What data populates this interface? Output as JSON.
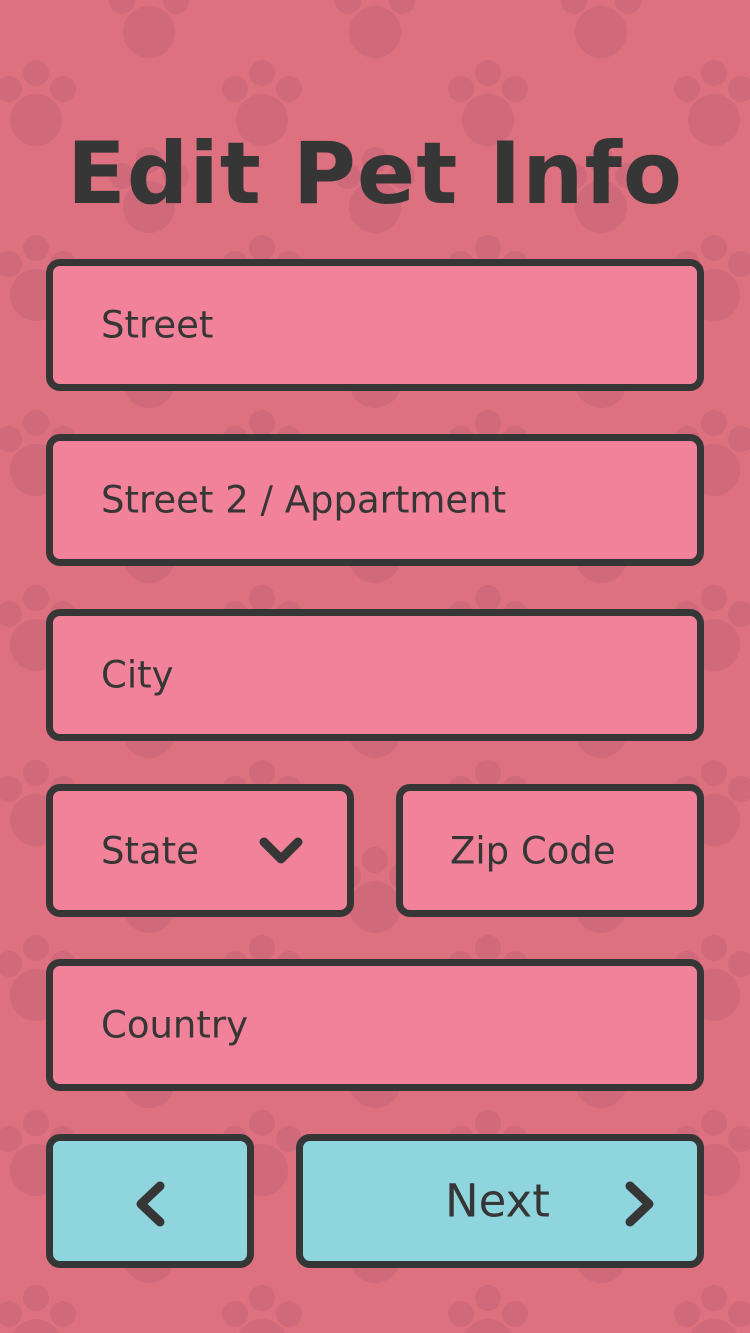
{
  "page": {
    "title": "Edit Pet Info"
  },
  "form": {
    "street": {
      "placeholder": "Street"
    },
    "street2": {
      "placeholder": "Street 2 / Appartment"
    },
    "city": {
      "placeholder": "City"
    },
    "state": {
      "placeholder": "State",
      "icon": "chevron-down-icon"
    },
    "zip": {
      "placeholder": "Zip Code"
    },
    "country": {
      "placeholder": "Country"
    }
  },
  "nav": {
    "back": {
      "icon": "chevron-left-icon"
    },
    "next": {
      "label": "Next",
      "icon": "chevron-right-icon"
    }
  },
  "colors": {
    "background": "#dd717f",
    "paw_pattern": "#d0697a",
    "field_fill": "#f28299",
    "button_fill": "#8fd5de",
    "outline_text": "#363636"
  }
}
